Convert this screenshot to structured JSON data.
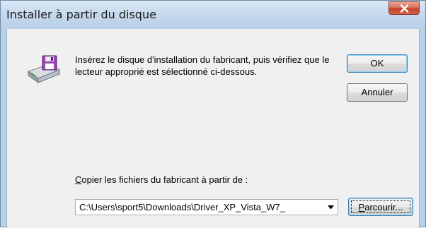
{
  "window": {
    "title": "Installer à partir du disque"
  },
  "dialog": {
    "instructions": "Insérez le disque d'installation du fabricant, puis vérifiez que le lecteur approprié est sélectionné ci-dessous.",
    "ok_label": "OK",
    "cancel_label": "Annuler",
    "copy_label_prefix": "C",
    "copy_label_rest": "opier les fichiers du fabricant à partir de :",
    "path_value": "C:\\Users\\sport5\\Downloads\\Driver_XP_Vista_W7_",
    "browse_label_prefix": "P",
    "browse_label_rest": "arcourir..."
  },
  "icons": {
    "close": "close-icon",
    "disk": "install-disk-icon",
    "dropdown": "chevron-down-icon"
  },
  "colors": {
    "close_button": "#c2412a",
    "titlebar": "#c7daee",
    "client_bg": "#f0f0f0",
    "disk_purple": "#9b3fb5"
  }
}
